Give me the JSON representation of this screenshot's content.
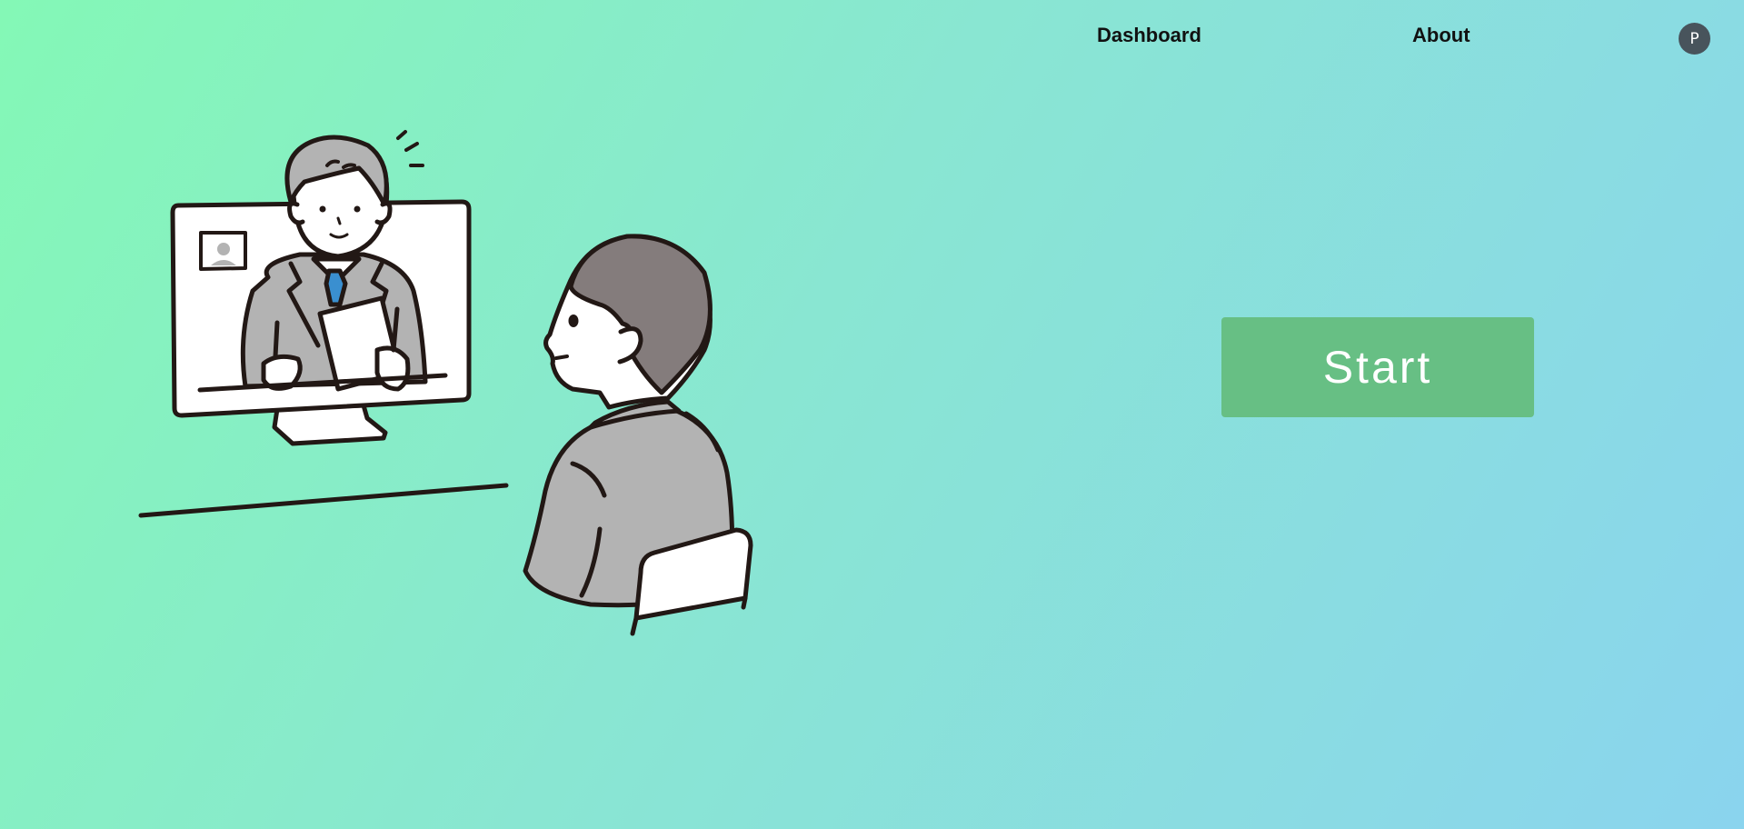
{
  "nav": {
    "dashboard_label": "Dashboard",
    "about_label": "About",
    "avatar_initial": "P"
  },
  "hero": {
    "start_label": "Start",
    "illustration_icon": "video-interview-illustration"
  },
  "colors": {
    "background_start": "#84f8b6",
    "background_end": "#8ad4ee",
    "start_button": "#67bf84",
    "avatar": "#48545c",
    "tie": "#3a8fd0",
    "suit": "#b3b3b3",
    "hair_back": "#847c7c"
  }
}
